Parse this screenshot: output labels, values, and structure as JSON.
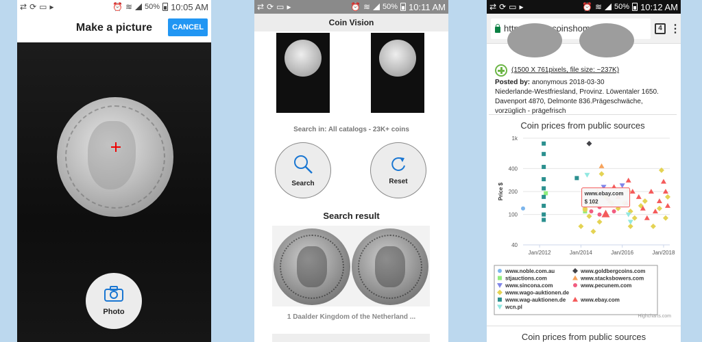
{
  "status_bars": [
    {
      "battery": "50%",
      "time": "10:05 AM"
    },
    {
      "battery": "50%",
      "time": "10:11 AM"
    },
    {
      "battery": "50%",
      "time": "10:12 AM"
    }
  ],
  "screen1": {
    "title": "Make a picture",
    "cancel_label": "CANCEL",
    "photo_label": "Photo"
  },
  "screen2": {
    "title": "Coin Vision",
    "search_in": "Search in: All catalogs - 23K+ coins",
    "search_label": "Search",
    "reset_label": "Reset",
    "result_title": "Search result",
    "result_caption": "1 Daalder Kingdom of the Netherland ..."
  },
  "screen3": {
    "url": "https://www.coinshome.net/e",
    "tab_count": "4",
    "image_link": "(1500 X 761pixels, file size: ~237K)",
    "posted_by_label": "Posted by:",
    "posted_by_value": "anonymous  2018-03-30",
    "description": "Niederlande-Westfriesland, Provinz. Löwentaler 1650. Davenport 4870, Delmonte 836.Prägeschwäche, vorzüglich - prägefrisch",
    "chart_title_2": "Coin prices from public sources",
    "credit": "Highcharts.com"
  },
  "chart_data": {
    "type": "scatter",
    "title": "Coin prices from public sources",
    "ylabel": "Price $",
    "xlabel": "",
    "y_log_scale": true,
    "ylim": [
      40,
      1000
    ],
    "xlim": [
      2011.2,
      2018.3
    ],
    "y_ticks": [
      {
        "label": "1k",
        "value": 1000
      },
      {
        "label": "400",
        "value": 400
      },
      {
        "label": "200",
        "value": 200
      },
      {
        "label": "100",
        "value": 100
      },
      {
        "label": "40",
        "value": 40
      }
    ],
    "x_ticks": [
      {
        "label": "Jan/2012",
        "value": 2012
      },
      {
        "label": "Jan/2014",
        "value": 2014
      },
      {
        "label": "Jan/2016",
        "value": 2016
      },
      {
        "label": "Jan/2018",
        "value": 2018
      }
    ],
    "tooltip": {
      "series": "www.ebay.com",
      "value": "$ 102",
      "x": 2015.2,
      "y": 102
    },
    "series": [
      {
        "name": "www.noble.com.au",
        "color": "#7cb5ec",
        "symbol": "circle",
        "points": [
          [
            2011.2,
            120
          ]
        ]
      },
      {
        "name": "www.goldbergcoins.com",
        "color": "#434348",
        "symbol": "diamond",
        "points": [
          [
            2014.4,
            850
          ]
        ]
      },
      {
        "name": "stjauctions.com",
        "color": "#90ed7d",
        "symbol": "square",
        "points": [
          [
            2012.3,
            190
          ],
          [
            2014.2,
            110
          ]
        ]
      },
      {
        "name": "www.stacksbowers.com",
        "color": "#f7a35c",
        "symbol": "triangle",
        "points": [
          [
            2015.0,
            430
          ],
          [
            2015.4,
            150
          ],
          [
            2016.3,
            210
          ],
          [
            2014.8,
            200
          ]
        ]
      },
      {
        "name": "www.sincona.com",
        "color": "#8085e9",
        "symbol": "triangle-down",
        "points": [
          [
            2015.1,
            230
          ],
          [
            2016.0,
            240
          ]
        ]
      },
      {
        "name": "www.pecunem.com",
        "color": "#f15c80",
        "symbol": "circle",
        "points": [
          [
            2014.7,
            155
          ],
          [
            2014.9,
            125
          ],
          [
            2015.3,
            160
          ],
          [
            2014.5,
            110
          ],
          [
            2015.6,
            110
          ],
          [
            2014.9,
            100
          ]
        ]
      },
      {
        "name": "www.wago-auktionen.de",
        "color": "#e4d354",
        "symbol": "diamond",
        "points": [
          [
            2014.2,
            115
          ],
          [
            2014.4,
            95
          ],
          [
            2014.6,
            140
          ],
          [
            2014.9,
            80
          ],
          [
            2015.2,
            170
          ],
          [
            2015.5,
            140
          ],
          [
            2015.8,
            120
          ],
          [
            2016.1,
            140
          ],
          [
            2016.4,
            110
          ],
          [
            2016.6,
            90
          ],
          [
            2016.9,
            130
          ],
          [
            2017.1,
            150
          ],
          [
            2017.5,
            70
          ],
          [
            2017.8,
            120
          ],
          [
            2018.1,
            90
          ],
          [
            2018.2,
            170
          ],
          [
            2014.6,
            60
          ],
          [
            2014.0,
            70
          ],
          [
            2016.4,
            70
          ],
          [
            2017.9,
            380
          ],
          [
            2015.0,
            340
          ],
          [
            2014.2,
            120
          ]
        ]
      },
      {
        "name": "www.wag-auktionen.de",
        "color": "#2b908f",
        "symbol": "square",
        "points": [
          [
            2012.2,
            850
          ],
          [
            2012.2,
            620
          ],
          [
            2012.2,
            420
          ],
          [
            2012.2,
            290
          ],
          [
            2012.2,
            220
          ],
          [
            2012.2,
            170
          ],
          [
            2012.2,
            130
          ],
          [
            2012.2,
            100
          ],
          [
            2012.2,
            85
          ],
          [
            2013.8,
            300
          ]
        ]
      },
      {
        "name": "www.ebay.com",
        "color": "#f45b5b",
        "symbol": "triangle",
        "points": [
          [
            2015.2,
            102
          ],
          [
            2015.6,
            230
          ],
          [
            2016.2,
            140
          ],
          [
            2016.5,
            200
          ],
          [
            2016.8,
            170
          ],
          [
            2017.0,
            120
          ],
          [
            2017.2,
            90
          ],
          [
            2017.4,
            200
          ],
          [
            2017.6,
            110
          ],
          [
            2017.8,
            150
          ],
          [
            2018.0,
            270
          ],
          [
            2018.1,
            200
          ],
          [
            2018.2,
            130
          ],
          [
            2016.3,
            280
          ],
          [
            2015.8,
            170
          ]
        ]
      },
      {
        "name": "wcn.pl",
        "color": "#91e8e1",
        "symbol": "triangle-down",
        "points": [
          [
            2014.3,
            330
          ],
          [
            2016.4,
            80
          ],
          [
            2016.3,
            100
          ]
        ]
      }
    ]
  }
}
